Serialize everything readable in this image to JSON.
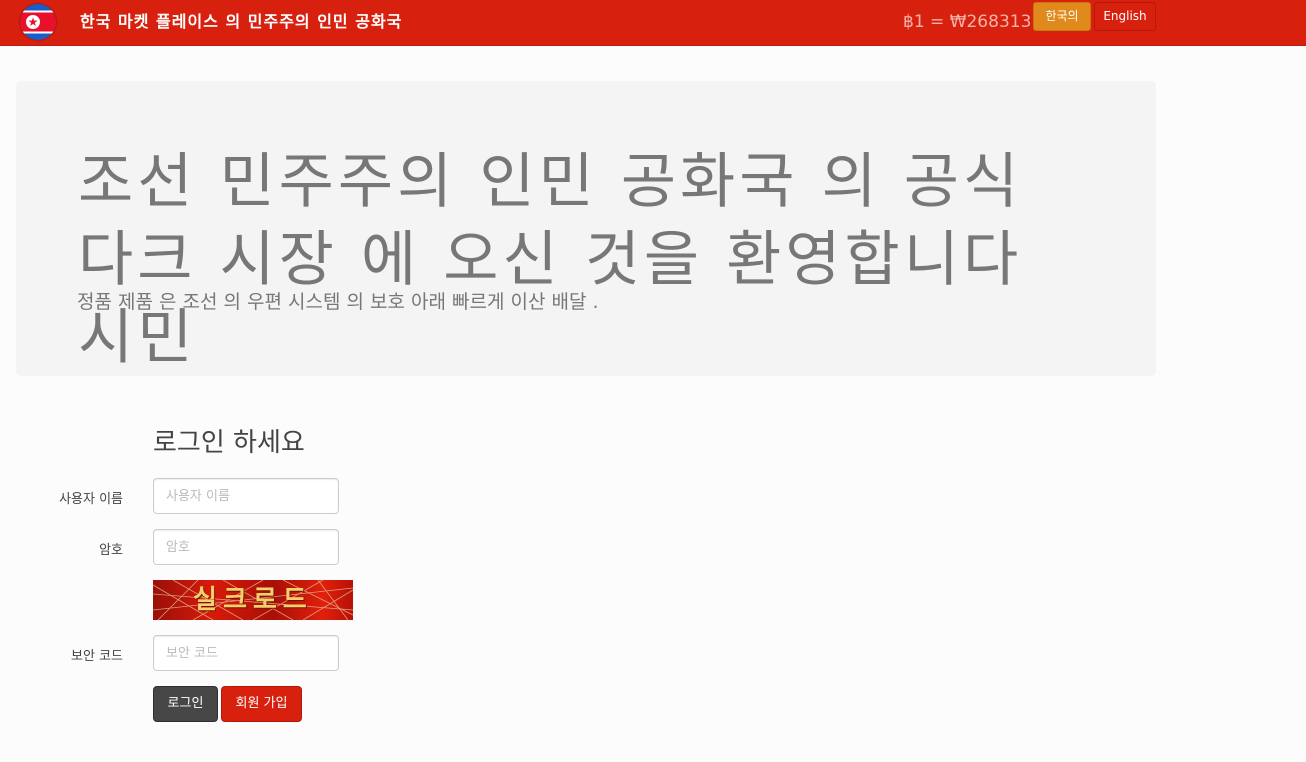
{
  "navbar": {
    "brand": "한국 마켓 플레이스 의 민주주의 인민 공화국",
    "logo_icon": "north-korea-flag-icon",
    "exchange_rate": "฿1 = ₩268313",
    "lang_korean": "한국의",
    "lang_english": "English"
  },
  "jumbotron": {
    "title": "조선 민주주의 인민 공화국 의 공식 다크 시장 에 오신 것을 환영합니다 시민",
    "subtitle": "정품 제품 은 조선 의 우편 시스템 의 보호 아래 빠르게 이산 배달 ."
  },
  "login": {
    "heading": "로그인 하세요",
    "username_label": "사용자 이름",
    "username_placeholder": "사용자 이름",
    "password_label": "암호",
    "password_placeholder": "암호",
    "captcha_text": "실크로드",
    "security_label": "보안 코드",
    "security_placeholder": "보안 코드",
    "login_button": "로그인",
    "register_button": "회원 가입"
  },
  "colors": {
    "navbar": "#d8200f",
    "korean_button": "#e08a1c",
    "login_button": "#474747",
    "register_button": "#d8200f"
  }
}
